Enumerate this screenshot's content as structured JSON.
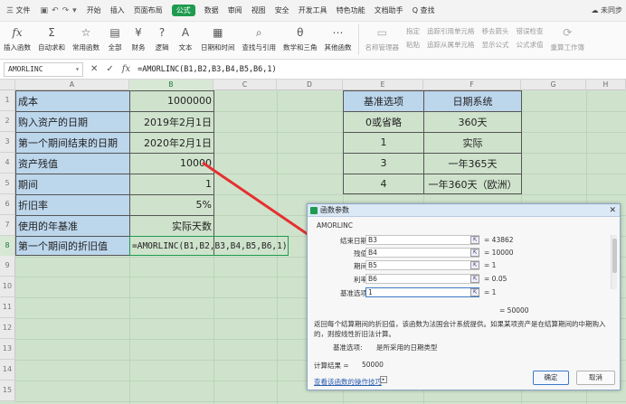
{
  "menubar": {
    "file_label": "三 文件",
    "tabs": [
      "开始",
      "插入",
      "页面布局",
      "公式",
      "数据",
      "审阅",
      "视图",
      "安全",
      "开发工具",
      "特色功能",
      "文档助手"
    ],
    "active_tab": "公式",
    "search_label": "Q 查找",
    "user_label": "未同步"
  },
  "ribbon": {
    "buttons": [
      "插入函数",
      "自动求和",
      "常用函数",
      "全部",
      "财务",
      "逻辑",
      "文本",
      "日期和时间",
      "查找与引用",
      "数学和三角",
      "其他函数"
    ],
    "dim_buttons": [
      "名称管理器",
      "粘贴"
    ],
    "small_items": [
      "指定",
      "追踪引用单元格",
      "追踪从属单元格",
      "移去箭头",
      "显示公式",
      "错误检查",
      "公式求值",
      "重算工作簿"
    ],
    "menu_suffix": "·"
  },
  "formula_bar": {
    "name_box": "AMORLINC",
    "formula": "=AMORLINC(B1,B2,B3,B4,B5,B6,1)",
    "fx_label": "fx"
  },
  "columns": [
    "A",
    "B",
    "C",
    "D",
    "E",
    "F",
    "G",
    "H"
  ],
  "rows": [
    "1",
    "2",
    "3",
    "4",
    "5",
    "6",
    "7",
    "8",
    "9",
    "10",
    "11",
    "12",
    "13",
    "14",
    "15"
  ],
  "cells": {
    "a": [
      "成本",
      "购入资产的日期",
      "第一个期间结束的日期",
      "资产残值",
      "期间",
      "折旧率",
      "使用的年基准",
      "第一个期间的折旧值"
    ],
    "b": [
      "1000000",
      "2019年2月1日",
      "2020年2月1日",
      "10000",
      "1",
      "5%",
      "实际天数"
    ],
    "b8_formula": "=AMORLINC(B1,B2,B3,B4,B5,B6,1)",
    "e": [
      "基准选项",
      "0或省略",
      "1",
      "3",
      "4"
    ],
    "f": [
      "日期系统",
      "360天",
      "实际",
      "一年365天",
      "一年360天（欧洲）"
    ]
  },
  "dialog": {
    "title": "函数参数",
    "function_name": "AMORLINC",
    "args": [
      {
        "label": "结束日期",
        "value": "B3",
        "result": "= 43862"
      },
      {
        "label": "残值",
        "value": "B4",
        "result": "= 10000"
      },
      {
        "label": "期间",
        "value": "B5",
        "result": "= 1"
      },
      {
        "label": "利率",
        "value": "B6",
        "result": "= 0.05"
      },
      {
        "label": "基准选项",
        "value": "1",
        "result": "= 1"
      }
    ],
    "total": "= 50000",
    "description": "返回每个结算期间的折旧值，该函数为法国会计系统提供。如果某项资产是在结算期间的中期购入的，则按线性折旧法计算。",
    "arg_desc_label": "基准选项:",
    "arg_desc": "是所采用的日期类型",
    "result_label": "计算结果 =",
    "result_value": "50000",
    "help_link": "查看该函数的操作技巧",
    "ok": "确定",
    "cancel": "取消",
    "close": "✕"
  },
  "colors": {
    "accent": "#1e9b4f",
    "sheet_bg": "#cfe3cc",
    "blue_cell": "#bcd6ec",
    "arrow": "#e63030"
  }
}
